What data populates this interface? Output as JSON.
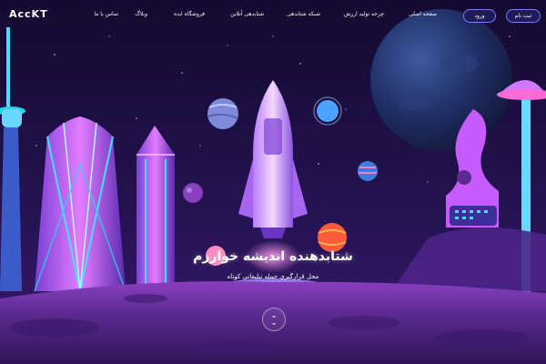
{
  "header": {
    "logo_text": "AccKT",
    "menu": [
      {
        "label": "صفحه اصلی"
      },
      {
        "label": "چرخه تولید ارزش"
      },
      {
        "label": "شبکه شتابدهی"
      },
      {
        "label": "شتابدهی آنلاین"
      },
      {
        "label": "فروشگاه ایده"
      },
      {
        "label": "وبلاگ"
      },
      {
        "label": "تماس با ما"
      }
    ],
    "signup_label": "ثبت نام",
    "login_label": "ورود"
  },
  "hero": {
    "title": "شتابدهنده اندیشه خوارزم",
    "subtitle": "محل قرارگیری جمله تبلیغاتی کوتاه"
  },
  "colors": {
    "sky_top": "#160b33",
    "sky_mid": "#2a1660",
    "ground": "#5a2a8a",
    "accent_pink": "#ff6ad5",
    "accent_cyan": "#43e0ff",
    "button_border": "#7b7dff"
  },
  "icons": {
    "scroll": "double-chevron-down-icon"
  }
}
